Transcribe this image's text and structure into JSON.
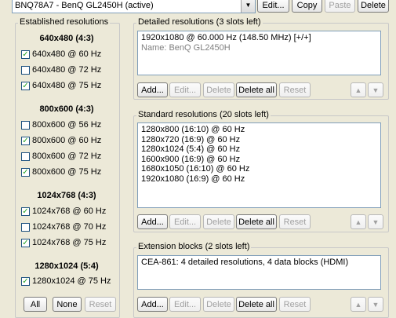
{
  "toolbar": {
    "monitor_select": "BNQ78A7 - BenQ GL2450H (active)",
    "edit": "Edit...",
    "copy": "Copy",
    "paste": "Paste",
    "delete": "Delete"
  },
  "established": {
    "title": "Established resolutions",
    "groups": [
      {
        "heading": "640x480 (4:3)",
        "items": [
          {
            "label": "640x480 @ 60 Hz",
            "checked": true
          },
          {
            "label": "640x480 @ 72 Hz",
            "checked": false
          },
          {
            "label": "640x480 @ 75 Hz",
            "checked": true
          }
        ]
      },
      {
        "heading": "800x600 (4:3)",
        "items": [
          {
            "label": "800x600 @ 56 Hz",
            "checked": false
          },
          {
            "label": "800x600 @ 60 Hz",
            "checked": true
          },
          {
            "label": "800x600 @ 72 Hz",
            "checked": false
          },
          {
            "label": "800x600 @ 75 Hz",
            "checked": true
          }
        ]
      },
      {
        "heading": "1024x768 (4:3)",
        "items": [
          {
            "label": "1024x768 @ 60 Hz",
            "checked": true
          },
          {
            "label": "1024x768 @ 70 Hz",
            "checked": false
          },
          {
            "label": "1024x768 @ 75 Hz",
            "checked": true
          }
        ]
      },
      {
        "heading": "1280x1024 (5:4)",
        "items": [
          {
            "label": "1280x1024 @ 75 Hz",
            "checked": true
          }
        ]
      }
    ],
    "all": "All",
    "none": "None",
    "reset": "Reset"
  },
  "detailed": {
    "title": "Detailed resolutions (3 slots left)",
    "lines": [
      "1920x1080 @ 60.000 Hz (148.50 MHz) [+/+]",
      "Name: BenQ GL2450H"
    ],
    "add": "Add...",
    "edit": "Edit...",
    "delete": "Delete",
    "delete_all": "Delete all",
    "reset": "Reset",
    "up": "▲",
    "down": "▼"
  },
  "standard": {
    "title": "Standard resolutions (20 slots left)",
    "lines": [
      "1280x800 (16:10) @ 60 Hz",
      "1280x720 (16:9) @ 60 Hz",
      "1280x1024 (5:4) @ 60 Hz",
      "1600x900 (16:9) @ 60 Hz",
      "1680x1050 (16:10) @ 60 Hz",
      "1920x1080 (16:9) @ 60 Hz"
    ],
    "add": "Add...",
    "edit": "Edit...",
    "delete": "Delete",
    "delete_all": "Delete all",
    "reset": "Reset",
    "up": "▲",
    "down": "▼"
  },
  "extension": {
    "title": "Extension blocks (2 slots left)",
    "lines": [
      "CEA-861: 4 detailed resolutions, 4 data blocks (HDMI)"
    ],
    "add": "Add...",
    "edit": "Edit...",
    "delete": "Delete",
    "delete_all": "Delete all",
    "reset": "Reset",
    "up": "▲",
    "down": "▼"
  }
}
